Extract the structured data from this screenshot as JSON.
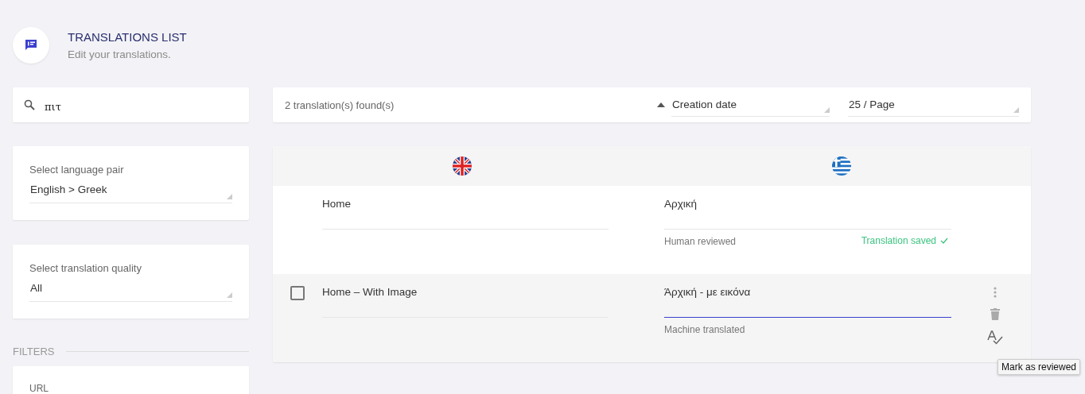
{
  "header": {
    "title": "TRANSLATIONS LIST",
    "subtitle": "Edit your translations."
  },
  "search": {
    "value": "πιτ"
  },
  "language_pair": {
    "label": "Select language pair",
    "value": "English > Greek"
  },
  "quality": {
    "label": "Select translation quality",
    "value": "All"
  },
  "filters": {
    "title": "FILTERS",
    "url_label": "URL"
  },
  "toolbar": {
    "count": "2 translation(s) found(s)",
    "sort": {
      "value": "Creation date"
    },
    "page_size": "25 / Page"
  },
  "columns": [
    {
      "kind": "uk"
    },
    {
      "kind": "greece"
    }
  ],
  "rows": [
    {
      "source": "Home",
      "target": "Αρχική",
      "status": "Human reviewed",
      "message": "Translation saved",
      "hovered": false,
      "focused": false,
      "checked": false
    },
    {
      "source": "Home – With Image",
      "target": "Άρχική - με εικόνα",
      "status": "Machine translated",
      "hovered": true,
      "focused": true,
      "checked": false
    }
  ],
  "tooltip": "Mark as reviewed"
}
